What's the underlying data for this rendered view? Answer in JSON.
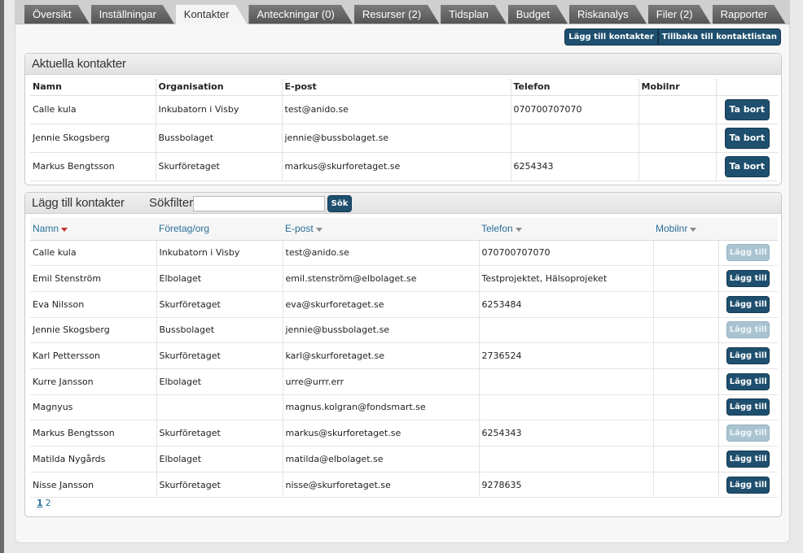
{
  "tabs": [
    {
      "label": "Översikt",
      "active": false
    },
    {
      "label": "Inställningar",
      "active": false
    },
    {
      "label": "Kontakter",
      "active": true
    },
    {
      "label": "Anteckningar (0)",
      "active": false
    },
    {
      "label": "Resurser (2)",
      "active": false
    },
    {
      "label": "Tidsplan",
      "active": false
    },
    {
      "label": "Budget",
      "active": false
    },
    {
      "label": "Riskanalys",
      "active": false
    },
    {
      "label": "Filer (2)",
      "active": false
    },
    {
      "label": "Rapporter",
      "active": false
    }
  ],
  "toolbar": {
    "add_contacts_label": "Lägg till kontakter",
    "back_label": "Tillbaka till kontaktlistan"
  },
  "current": {
    "title": "Aktuella kontakter",
    "columns": [
      "Namn",
      "Organisation",
      "E-post",
      "Telefon",
      "Mobilnr"
    ],
    "remove_label": "Ta bort",
    "rows": [
      {
        "name": "Calle kula",
        "org": "Inkubatorn i Visby",
        "email": "test@anido.se",
        "phone": "070700707070",
        "mobile": ""
      },
      {
        "name": "Jennie Skogsberg",
        "org": "Bussbolaget",
        "email": "jennie@bussbolaget.se",
        "phone": "",
        "mobile": ""
      },
      {
        "name": "Markus Bengtsson",
        "org": "Skurföretaget",
        "email": "markus@skurforetaget.se",
        "phone": "6254343",
        "mobile": ""
      }
    ]
  },
  "add": {
    "title": "Lägg till kontakter",
    "search_label": "Sökfilter:",
    "search_value": "",
    "search_button": "Sök",
    "columns": [
      "Namn",
      "Företag/org",
      "E-post",
      "Telefon",
      "Mobilnr"
    ],
    "add_label": "Lägg till",
    "rows": [
      {
        "name": "Calle kula",
        "org": "Inkubatorn i Visby",
        "email": "test@anido.se",
        "phone": "070700707070",
        "mobile": "",
        "disabled": true
      },
      {
        "name": "Emil Stenström",
        "org": "Elbolaget",
        "email": "emil.stenström@elbolaget.se",
        "phone": "Testprojektet, Hälsoprojeket",
        "mobile": "",
        "disabled": false
      },
      {
        "name": "Eva Nilsson",
        "org": "Skurföretaget",
        "email": "eva@skurforetaget.se",
        "phone": "6253484",
        "mobile": "",
        "disabled": false
      },
      {
        "name": "Jennie Skogsberg",
        "org": "Bussbolaget",
        "email": "jennie@bussbolaget.se",
        "phone": "",
        "mobile": "",
        "disabled": true
      },
      {
        "name": "Karl Pettersson",
        "org": "Skurföretaget",
        "email": "karl@skurforetaget.se",
        "phone": "2736524",
        "mobile": "",
        "disabled": false
      },
      {
        "name": "Kurre Jansson",
        "org": "Elbolaget",
        "email": "urre@urrr.err",
        "phone": "",
        "mobile": "",
        "disabled": false
      },
      {
        "name": "Magnyus",
        "org": "",
        "email": "magnus.kolgran@fondsmart.se",
        "phone": "",
        "mobile": "",
        "disabled": false
      },
      {
        "name": "Markus Bengtsson",
        "org": "Skurföretaget",
        "email": "markus@skurforetaget.se",
        "phone": "6254343",
        "mobile": "",
        "disabled": true
      },
      {
        "name": "Matilda Nygårds",
        "org": "Elbolaget",
        "email": "matilda@elbolaget.se",
        "phone": "",
        "mobile": "",
        "disabled": false
      },
      {
        "name": "Nisse Jansson",
        "org": "Skurföretaget",
        "email": "nisse@skurforetaget.se",
        "phone": "9278635",
        "mobile": "",
        "disabled": false
      }
    ],
    "pages": [
      "1",
      "2"
    ]
  }
}
